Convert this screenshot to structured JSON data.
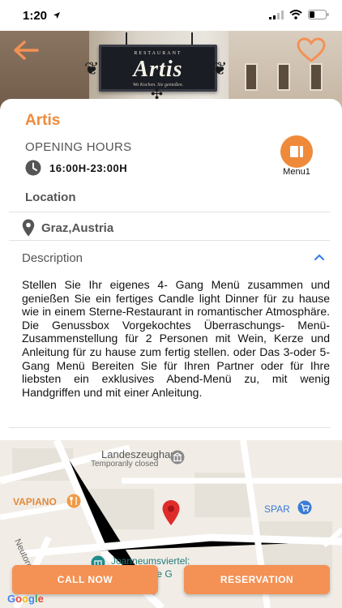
{
  "status": {
    "time": "1:20"
  },
  "restaurant": {
    "name": "Artis",
    "sign_small": "RESTAURANT",
    "sign_name": "Artis",
    "sign_tagline": "Wo Kochen. Sie genießen."
  },
  "hours": {
    "label": "OPENING HOURS",
    "value": "16:00H-23:00H"
  },
  "menu": {
    "label": "Menu1"
  },
  "location": {
    "label": "Location",
    "address": "Graz,Austria"
  },
  "description": {
    "label": "Description",
    "text": "Stellen Sie Ihr eigenes 4- Gang Menü zusammen und genießen Sie ein fertiges Candle light Dinner für zu hause wie in einem Sterne-Restaurant in romantischer Atmosphäre. Die Genussbox Vorgekochtes Überraschungs- Menü-Zusammenstellung für 2 Personen mit Wein, Kerze und Anleitung für zu hause zum fertig stellen. oder Das 3-oder 5-Gang Menü Bereiten Sie für Ihren Partner oder für Ihre liebsten ein exklusives Abend-Menü zu, mit wenig Handgriffen und mit einer Anleitung."
  },
  "map": {
    "labels": {
      "landeszeughaus": "Landeszeughaus",
      "temporarily_closed": "Temporarily closed",
      "vapiano": "VAPIANO",
      "spar": "SPAR",
      "neutorgasse": "Neutorga",
      "joanneum": "Joanneumsviertel:",
      "galerie": "erie G"
    },
    "google": "Google"
  },
  "actions": {
    "call_now": "CALL NOW",
    "reservation": "RESERVATION"
  },
  "colors": {
    "accent": "#ef8a3a",
    "button": "#f49155",
    "pin": "#e02b2b"
  }
}
